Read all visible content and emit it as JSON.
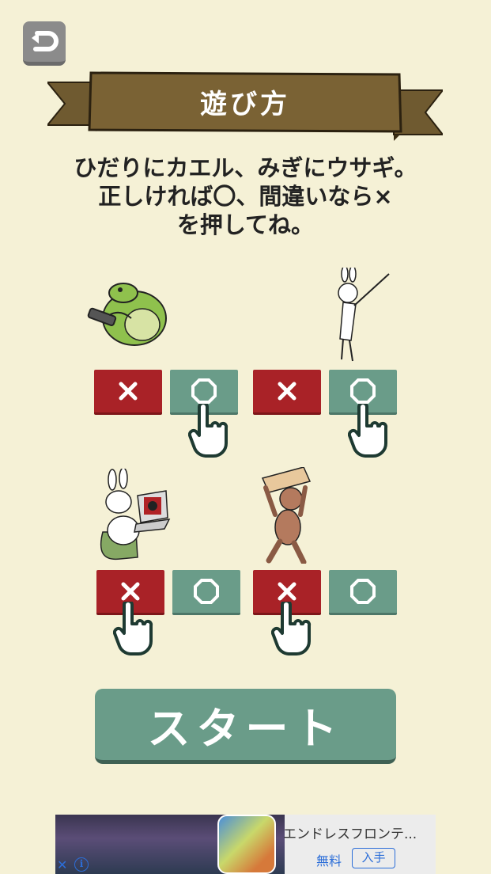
{
  "header": {
    "back_icon": "undo-arrow-icon",
    "banner_title": "遊び方"
  },
  "instructions": {
    "line1": "ひだりにカエル、みぎにウサギ。",
    "line2": "正しければ〇、間違いなら×",
    "line3": "を押してね。"
  },
  "examples": [
    {
      "left": "frog-with-phone",
      "right": "rabbit-pointing",
      "correct": "circle",
      "cross_icon": "cross-icon",
      "circle_icon": "octagon-circle-icon"
    },
    {
      "left": "rabbit-with-laptop",
      "right": "monkey-carrying-box",
      "correct": "cross",
      "cross_icon": "cross-icon",
      "circle_icon": "octagon-circle-icon"
    }
  ],
  "start_button": {
    "label": "スタート"
  },
  "ad": {
    "title": "エンドレスフロンテ...",
    "price": "無料",
    "install": "入手",
    "close": "✕",
    "info": "i"
  },
  "colors": {
    "background": "#f5f1d6",
    "banner": "#7a6234",
    "cross_button": "#a92227",
    "circle_button": "#6a9c89",
    "start_button": "#6a9c89"
  }
}
